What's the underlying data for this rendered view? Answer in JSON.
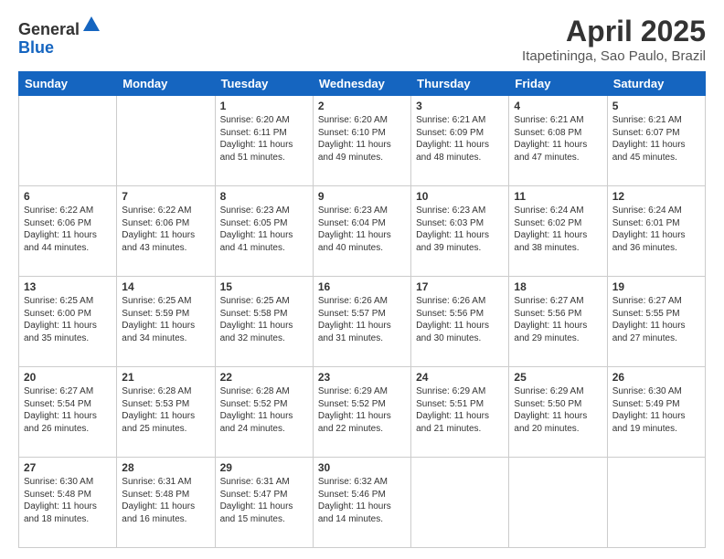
{
  "header": {
    "logo_general": "General",
    "logo_blue": "Blue",
    "month_title": "April 2025",
    "location": "Itapetininga, Sao Paulo, Brazil"
  },
  "weekdays": [
    "Sunday",
    "Monday",
    "Tuesday",
    "Wednesday",
    "Thursday",
    "Friday",
    "Saturday"
  ],
  "weeks": [
    [
      {
        "day": "",
        "info": ""
      },
      {
        "day": "",
        "info": ""
      },
      {
        "day": "1",
        "info": "Sunrise: 6:20 AM\nSunset: 6:11 PM\nDaylight: 11 hours and 51 minutes."
      },
      {
        "day": "2",
        "info": "Sunrise: 6:20 AM\nSunset: 6:10 PM\nDaylight: 11 hours and 49 minutes."
      },
      {
        "day": "3",
        "info": "Sunrise: 6:21 AM\nSunset: 6:09 PM\nDaylight: 11 hours and 48 minutes."
      },
      {
        "day": "4",
        "info": "Sunrise: 6:21 AM\nSunset: 6:08 PM\nDaylight: 11 hours and 47 minutes."
      },
      {
        "day": "5",
        "info": "Sunrise: 6:21 AM\nSunset: 6:07 PM\nDaylight: 11 hours and 45 minutes."
      }
    ],
    [
      {
        "day": "6",
        "info": "Sunrise: 6:22 AM\nSunset: 6:06 PM\nDaylight: 11 hours and 44 minutes."
      },
      {
        "day": "7",
        "info": "Sunrise: 6:22 AM\nSunset: 6:06 PM\nDaylight: 11 hours and 43 minutes."
      },
      {
        "day": "8",
        "info": "Sunrise: 6:23 AM\nSunset: 6:05 PM\nDaylight: 11 hours and 41 minutes."
      },
      {
        "day": "9",
        "info": "Sunrise: 6:23 AM\nSunset: 6:04 PM\nDaylight: 11 hours and 40 minutes."
      },
      {
        "day": "10",
        "info": "Sunrise: 6:23 AM\nSunset: 6:03 PM\nDaylight: 11 hours and 39 minutes."
      },
      {
        "day": "11",
        "info": "Sunrise: 6:24 AM\nSunset: 6:02 PM\nDaylight: 11 hours and 38 minutes."
      },
      {
        "day": "12",
        "info": "Sunrise: 6:24 AM\nSunset: 6:01 PM\nDaylight: 11 hours and 36 minutes."
      }
    ],
    [
      {
        "day": "13",
        "info": "Sunrise: 6:25 AM\nSunset: 6:00 PM\nDaylight: 11 hours and 35 minutes."
      },
      {
        "day": "14",
        "info": "Sunrise: 6:25 AM\nSunset: 5:59 PM\nDaylight: 11 hours and 34 minutes."
      },
      {
        "day": "15",
        "info": "Sunrise: 6:25 AM\nSunset: 5:58 PM\nDaylight: 11 hours and 32 minutes."
      },
      {
        "day": "16",
        "info": "Sunrise: 6:26 AM\nSunset: 5:57 PM\nDaylight: 11 hours and 31 minutes."
      },
      {
        "day": "17",
        "info": "Sunrise: 6:26 AM\nSunset: 5:56 PM\nDaylight: 11 hours and 30 minutes."
      },
      {
        "day": "18",
        "info": "Sunrise: 6:27 AM\nSunset: 5:56 PM\nDaylight: 11 hours and 29 minutes."
      },
      {
        "day": "19",
        "info": "Sunrise: 6:27 AM\nSunset: 5:55 PM\nDaylight: 11 hours and 27 minutes."
      }
    ],
    [
      {
        "day": "20",
        "info": "Sunrise: 6:27 AM\nSunset: 5:54 PM\nDaylight: 11 hours and 26 minutes."
      },
      {
        "day": "21",
        "info": "Sunrise: 6:28 AM\nSunset: 5:53 PM\nDaylight: 11 hours and 25 minutes."
      },
      {
        "day": "22",
        "info": "Sunrise: 6:28 AM\nSunset: 5:52 PM\nDaylight: 11 hours and 24 minutes."
      },
      {
        "day": "23",
        "info": "Sunrise: 6:29 AM\nSunset: 5:52 PM\nDaylight: 11 hours and 22 minutes."
      },
      {
        "day": "24",
        "info": "Sunrise: 6:29 AM\nSunset: 5:51 PM\nDaylight: 11 hours and 21 minutes."
      },
      {
        "day": "25",
        "info": "Sunrise: 6:29 AM\nSunset: 5:50 PM\nDaylight: 11 hours and 20 minutes."
      },
      {
        "day": "26",
        "info": "Sunrise: 6:30 AM\nSunset: 5:49 PM\nDaylight: 11 hours and 19 minutes."
      }
    ],
    [
      {
        "day": "27",
        "info": "Sunrise: 6:30 AM\nSunset: 5:48 PM\nDaylight: 11 hours and 18 minutes."
      },
      {
        "day": "28",
        "info": "Sunrise: 6:31 AM\nSunset: 5:48 PM\nDaylight: 11 hours and 16 minutes."
      },
      {
        "day": "29",
        "info": "Sunrise: 6:31 AM\nSunset: 5:47 PM\nDaylight: 11 hours and 15 minutes."
      },
      {
        "day": "30",
        "info": "Sunrise: 6:32 AM\nSunset: 5:46 PM\nDaylight: 11 hours and 14 minutes."
      },
      {
        "day": "",
        "info": ""
      },
      {
        "day": "",
        "info": ""
      },
      {
        "day": "",
        "info": ""
      }
    ]
  ]
}
